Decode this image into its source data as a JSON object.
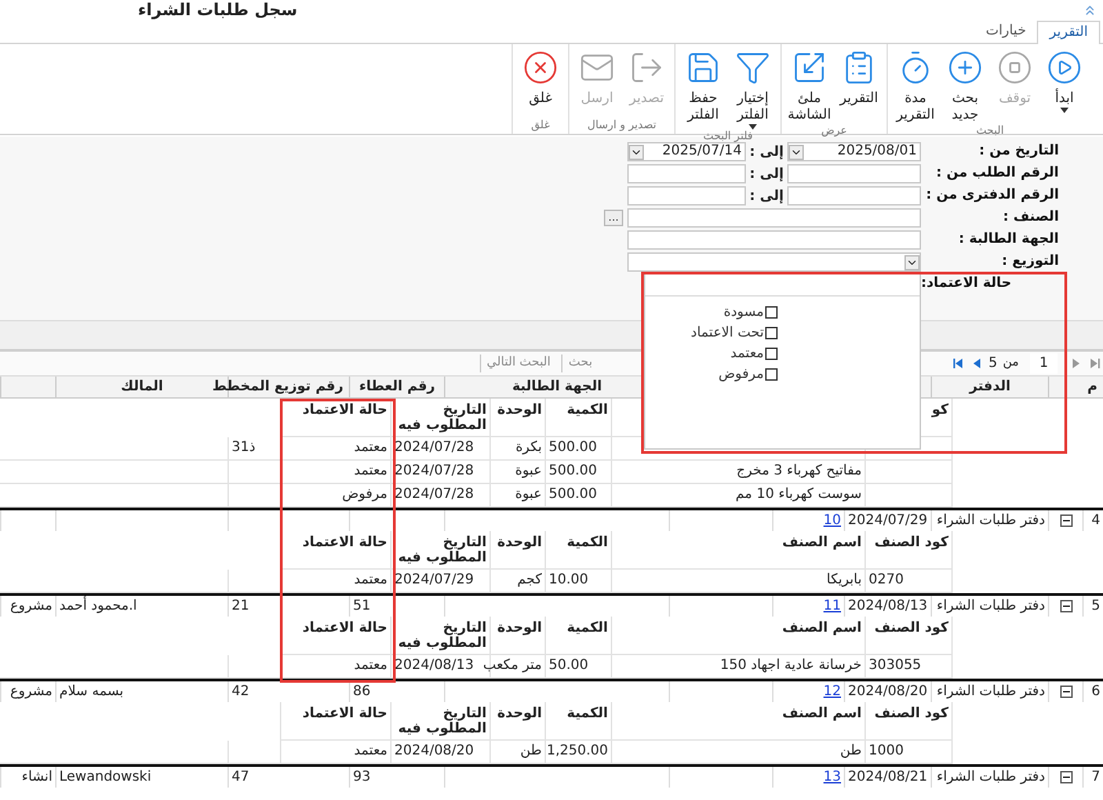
{
  "window": {
    "title": "سجل طلبات الشراء"
  },
  "tabs": [
    {
      "label": "التقرير",
      "selected": true
    },
    {
      "label": "خيارات",
      "selected": false
    }
  ],
  "ribbon_groups": [
    {
      "label": "البحث",
      "buttons": [
        {
          "label": "ابدأ",
          "disabled": false,
          "dropdown": true
        },
        {
          "label": "توقف",
          "disabled": true,
          "dropdown": false
        },
        {
          "label": "بحث جديد",
          "disabled": false,
          "dropdown": false
        },
        {
          "label": "مدة التقرير",
          "disabled": false,
          "dropdown": false
        }
      ]
    },
    {
      "label": "عرض",
      "buttons": [
        {
          "label": "التقرير",
          "disabled": false,
          "dropdown": false
        },
        {
          "label": "ملئ الشاشة",
          "disabled": false,
          "dropdown": false
        }
      ]
    },
    {
      "label": "فلتر البحث",
      "buttons": [
        {
          "label": "إختيار الفلتر",
          "disabled": false,
          "dropdown": true
        },
        {
          "label": "حفظ الفلتر",
          "disabled": false,
          "dropdown": false
        }
      ]
    },
    {
      "label": "تصدير و ارسال",
      "buttons": [
        {
          "label": "تصدير",
          "disabled": true,
          "dropdown": false
        },
        {
          "label": "ارسل",
          "disabled": true,
          "dropdown": false
        }
      ]
    },
    {
      "label": "غلق",
      "buttons": [
        {
          "label": "غلق",
          "disabled": false,
          "dropdown": false
        }
      ]
    }
  ],
  "filters": [
    {
      "kind": "date_range",
      "label": "التاريخ من :",
      "from": "2025/08/01",
      "to_label": "إلى :",
      "to": "2025/07/14"
    },
    {
      "kind": "range",
      "label": "الرقم الطلب من :",
      "to_label": "إلى :"
    },
    {
      "kind": "range",
      "label": "الرقم الدفترى من :",
      "to_label": "إلى :"
    },
    {
      "kind": "lookup",
      "label": "الصنف :",
      "button": "..."
    },
    {
      "kind": "text",
      "label": "الجهة الطالبة :"
    },
    {
      "kind": "select",
      "label": "التوزيع :"
    },
    {
      "kind": "multi",
      "label": "حالة الاعتماد:",
      "expanded": true,
      "options": [
        {
          "label": "مسودة",
          "checked": false
        },
        {
          "label": "تحت الاعتماد",
          "checked": false
        },
        {
          "label": "معتمد",
          "checked": false
        },
        {
          "label": "مرفوض",
          "checked": false
        }
      ]
    }
  ],
  "pager": {
    "page": "1",
    "of_label": "من",
    "total": "5"
  },
  "search_buttons": [
    "بحث",
    "البحث التالي"
  ],
  "grid": {
    "columns": [
      "م",
      "الدفتر",
      "الجهة الطالبة",
      "رقم العطاء",
      "رقم توزيع المخطط",
      "المالك"
    ],
    "groups": [
      {
        "details": {
          "columns": [
            "كو",
            "",
            "الكمية",
            "الوحدة",
            "التاريخ المطلوب فيه",
            "حالة الاعتماد"
          ],
          "rows": [
            {
              "cells": [
                "",
                "",
                "500.00",
                "بكرة",
                "2024/07/28",
                "معتمد"
              ],
              "extra": "3ذ1"
            },
            {
              "cells": [
                "",
                "مفاتيح  كهرباء 3 مخرج",
                "500.00",
                "عبوة",
                "2024/07/28",
                "معتمد"
              ]
            },
            {
              "cells": [
                "",
                "سوست كهرباء 10 مم",
                "500.00",
                "عبوة",
                "2024/07/28",
                "مرفوض"
              ]
            }
          ]
        }
      },
      {
        "row": {
          "number": "4",
          "expanded": true,
          "book": "دفتر طلبات الشراء",
          "date": "2024/07/29",
          "link": "10"
        },
        "details": {
          "columns": [
            "كود الصنف",
            "اسم الصنف",
            "الكمية",
            "الوحدة",
            "التاريخ المطلوب فيه",
            "حالة الاعتماد"
          ],
          "rows": [
            {
              "cells": [
                "0270",
                "بابريكا",
                "10.00",
                "كجم",
                "2024/07/29",
                "معتمد"
              ]
            }
          ]
        }
      },
      {
        "row": {
          "number": "5",
          "expanded": true,
          "book": "دفتر طلبات الشراء",
          "date": "2024/08/13",
          "link": "11",
          "tender": "51",
          "plan": "21",
          "owner": "ا.محمود أحمد",
          "column_11": "مشروع"
        },
        "details": {
          "columns": [
            "كود الصنف",
            "اسم الصنف",
            "الكمية",
            "الوحدة",
            "التاريخ المطلوب فيه",
            "حالة الاعتماد"
          ],
          "rows": [
            {
              "cells": [
                "303055",
                "خرسانة عادية اجهاد 150",
                "50.00",
                "متر مكعب",
                "2024/08/13",
                "معتمد"
              ]
            }
          ]
        }
      },
      {
        "row": {
          "number": "6",
          "expanded": true,
          "book": "دفتر طلبات الشراء",
          "date": "2024/08/20",
          "link": "12",
          "tender": "86",
          "plan": "42",
          "owner": "بسمه سلام",
          "column_11": "مشروع"
        },
        "details": {
          "columns": [
            "كود الصنف",
            "اسم الصنف",
            "الكمية",
            "الوحدة",
            "التاريخ المطلوب فيه",
            "حالة الاعتماد"
          ],
          "rows": [
            {
              "cells": [
                "1000",
                "طن",
                "1,250.00",
                "طن",
                "2024/08/20",
                "معتمد"
              ]
            }
          ]
        }
      },
      {
        "row": {
          "number": "7",
          "expanded": true,
          "book": "دفتر طلبات الشراء",
          "date": "2024/08/21",
          "link": "13",
          "tender": "93",
          "plan": "47",
          "owner": "Lewandowski",
          "column_11": "انشاء"
        }
      }
    ]
  }
}
